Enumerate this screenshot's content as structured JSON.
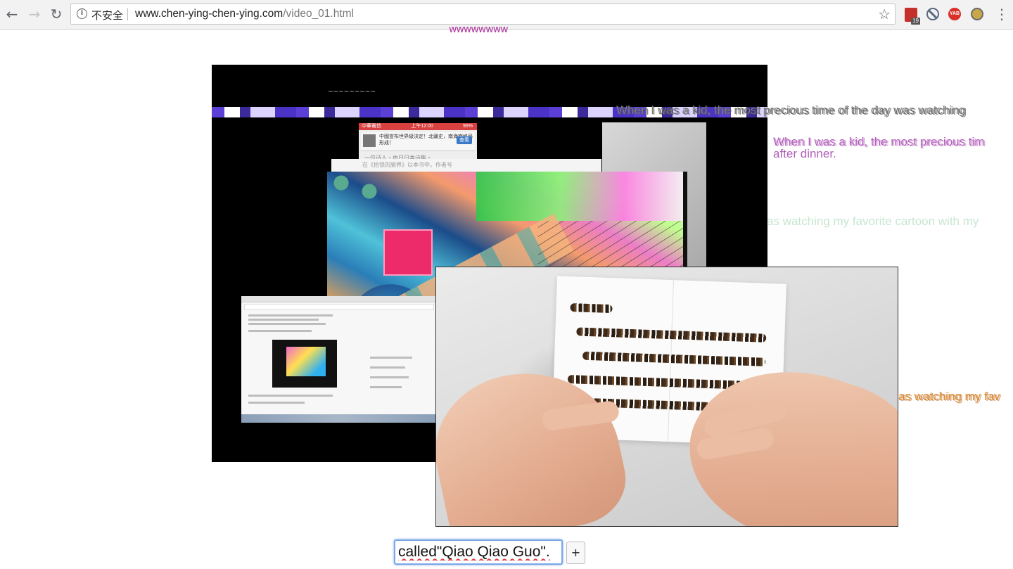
{
  "browser": {
    "back_icon": "←",
    "forward_icon": "→",
    "reload_icon": "↻",
    "security_label": "不安全",
    "url_host": "www.chen-ying-chen-ying.com",
    "url_path": "/video_01.html",
    "bookmark_icon": "☆",
    "menu_icon": "⋮",
    "extensions": {
      "calendar_badge": "19",
      "yab_label": "YAB"
    }
  },
  "page": {
    "wavy_top": "wwwwwwww",
    "tiny_wave": "~~~~~~~~~",
    "overlay_texts": {
      "line1": "When I was a kid, the most precious time of the day was watching",
      "line2a": "When I was a kid, the most precious tim",
      "line2b": "after dinner.",
      "line3": "as watching my favorite cartoon with my",
      "line4": "as watching my fav"
    },
    "phone_screenshot": {
      "carrier": "中華電信",
      "time": "上午12:00",
      "battery": "96%",
      "notification": "中國宣布世界級決定！北疆史，南海南格局形成！",
      "notification_button": "查看",
      "line1": "一位诗人・由日日本诗集・",
      "line2": "在《拾锁的腿界》以本书中，作者号"
    },
    "input": {
      "value": "called\"Qiao Qiao Guo\"."
    },
    "plus_button_label": "+"
  },
  "colors": {
    "input_focus": "#7aa7e8",
    "spellcheck": "#e04040",
    "overlay_purple": "#b15fba",
    "overlay_orange": "#e08a2d"
  }
}
